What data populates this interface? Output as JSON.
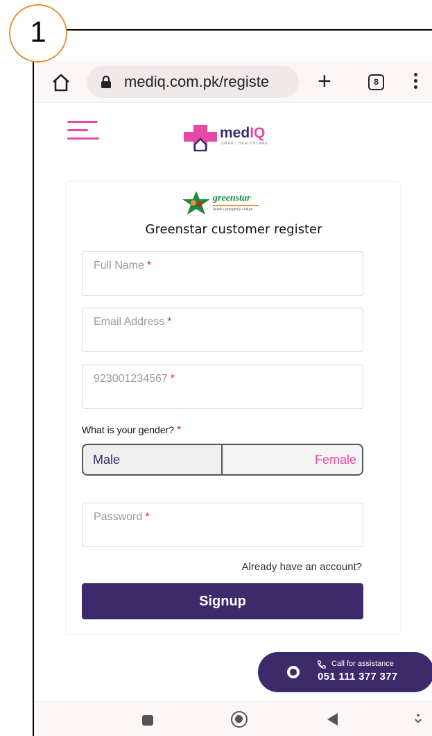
{
  "annotation": {
    "step_number": "1"
  },
  "browser": {
    "url": "mediq.com.pk/registe",
    "tab_count": "8",
    "icons": [
      "home-icon",
      "lock-icon",
      "plus-icon",
      "tabs-icon",
      "more-icon"
    ]
  },
  "site": {
    "logo_text_prefix": "med",
    "logo_text_suffix": "IQ",
    "logo_tagline": "SMART HEALTHCARE"
  },
  "form": {
    "partner_logo_name": "greenstar",
    "partner_logo_tagline": "health • prosperity • future",
    "title": "Greenstar customer register",
    "fields": {
      "full_name": {
        "placeholder": "Full Name",
        "required_mark": "*"
      },
      "email": {
        "placeholder": "Email Address",
        "required_mark": "*"
      },
      "phone": {
        "placeholder": "923001234567",
        "required_mark": "*"
      },
      "password": {
        "placeholder": "Password",
        "required_mark": "*"
      }
    },
    "gender": {
      "label": "What is your gender?",
      "required_mark": "*",
      "options": [
        "Male",
        "Female"
      ]
    },
    "login_link": "Already have an account?",
    "submit_label": "Signup"
  },
  "assistance": {
    "title": "Call for assistance",
    "phone": "051 111 377 377"
  },
  "colors": {
    "brand_purple": "#3c2a6b",
    "brand_pink": "#e64aa5",
    "required_red": "#d91f26",
    "annotation_orange": "#e8903a"
  }
}
